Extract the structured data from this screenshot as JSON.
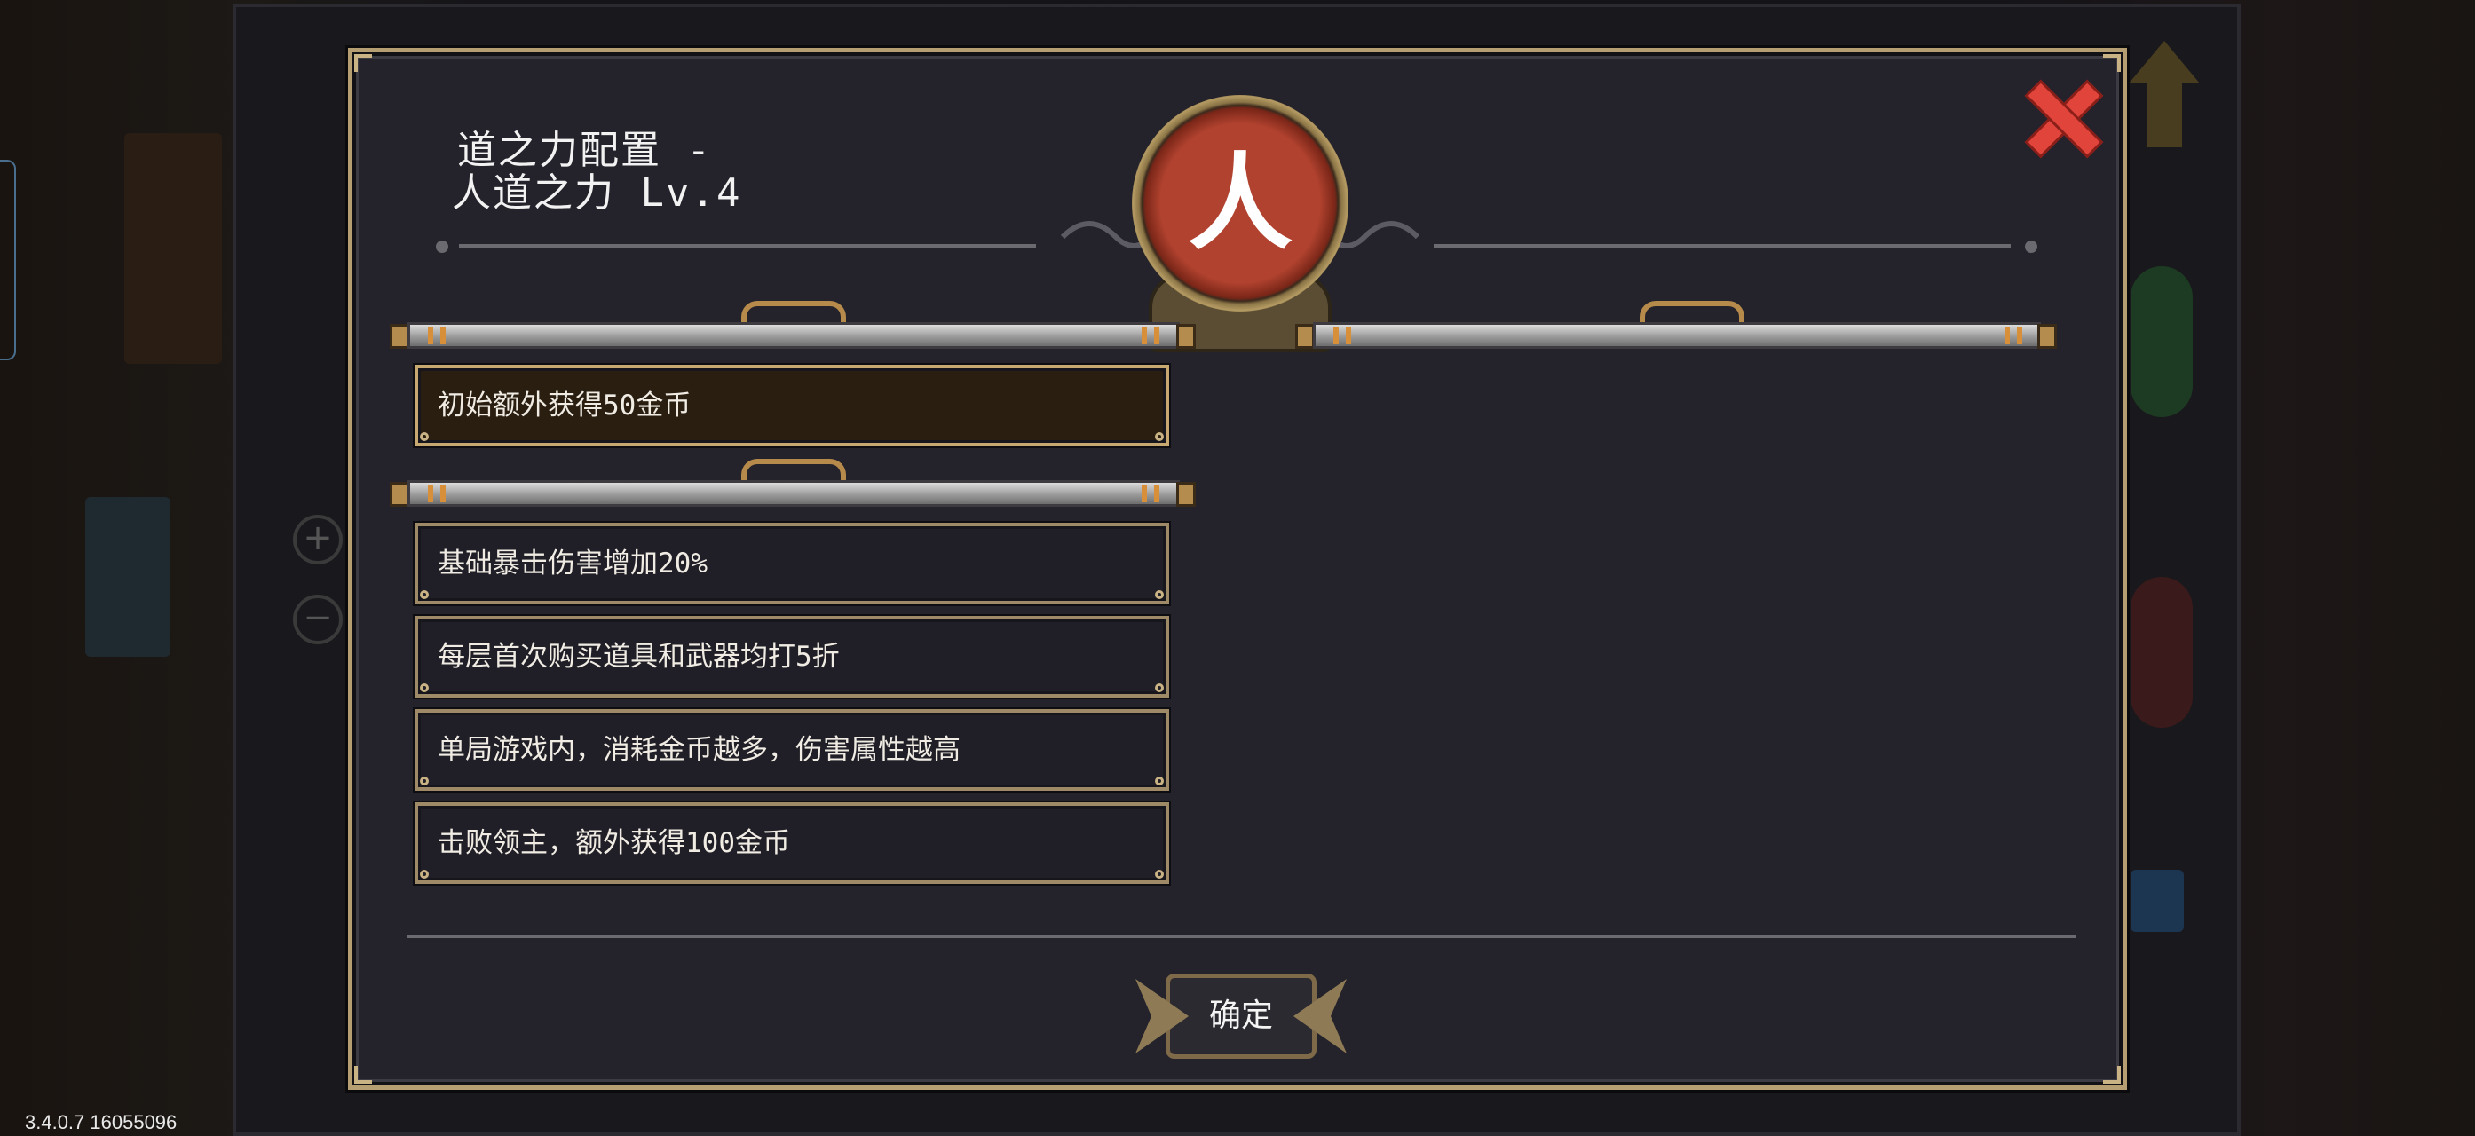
{
  "version_label": "3.4.0.7 16055096",
  "dialog": {
    "title_line1": "道之力配置 -",
    "title_line2": "人道之力 Lv.4",
    "emblem_glyph": "人",
    "close_icon": "close-x-icon",
    "confirm_label": "确定"
  },
  "slots": {
    "top": [
      {
        "text": "初始额外获得50金币",
        "selected": true
      }
    ],
    "bottom": [
      {
        "text": "基础暴击伤害增加20%"
      },
      {
        "text": "每层首次购买道具和武器均打5折"
      },
      {
        "text": "单局游戏内，消耗金币越多，伤害属性越高"
      },
      {
        "text": "击败领主，额外获得100金币"
      }
    ]
  },
  "colors": {
    "panel_bg": "#24232b",
    "frame_gold": "#b59f72",
    "close_red": "#e0443a",
    "emblem_red": "#b1422f",
    "accent_orange": "#d88f3a"
  }
}
